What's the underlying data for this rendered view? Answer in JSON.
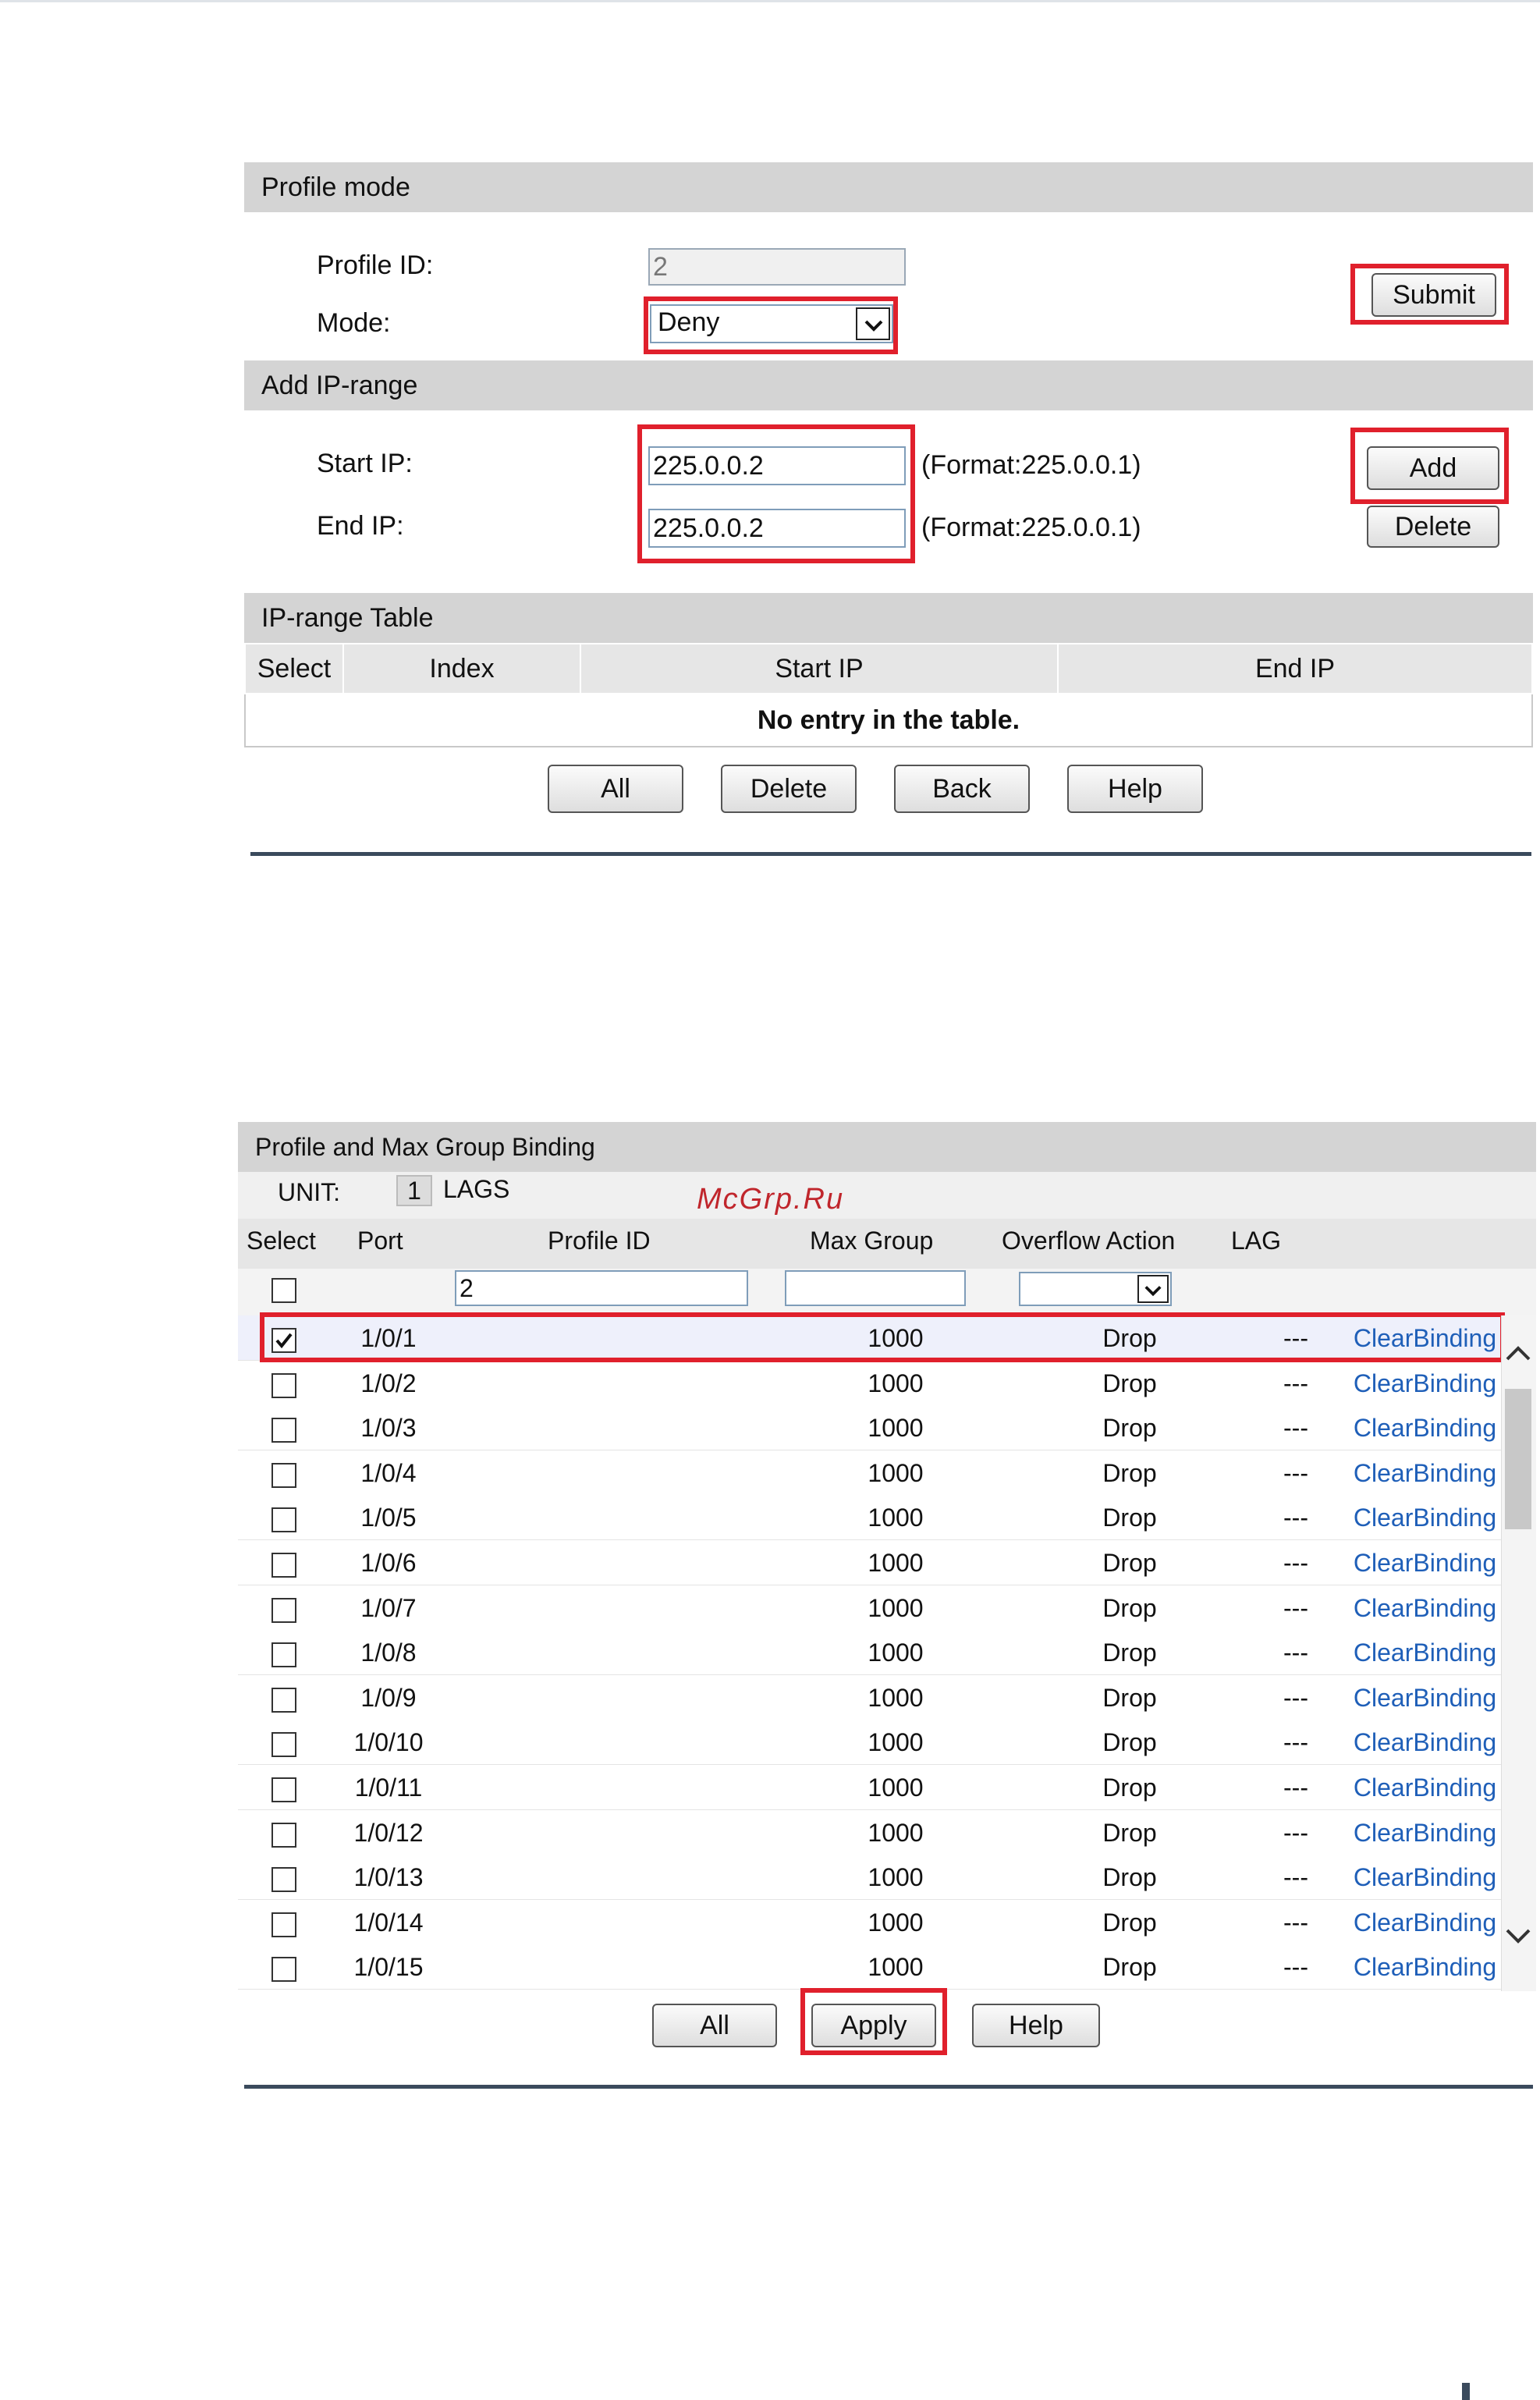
{
  "profile_form": {
    "section_profile_mode": "Profile mode",
    "profile_id_label": "Profile ID:",
    "profile_id_value": "2",
    "mode_label": "Mode:",
    "mode_value": "Deny",
    "submit_label": "Submit",
    "section_add_ip_range": "Add IP-range",
    "start_ip_label": "Start IP:",
    "start_ip_value": "225.0.0.2",
    "end_ip_label": "End IP:",
    "end_ip_value": "225.0.0.2",
    "format_hint": "(Format:225.0.0.1)",
    "add_label": "Add",
    "delete_label": "Delete",
    "section_ip_range_table": "IP-range Table",
    "table_headers": [
      "Select",
      "Index",
      "Start IP",
      "End IP"
    ],
    "empty_message": "No entry in the table.",
    "bottom_buttons": [
      "All",
      "Delete",
      "Back",
      "Help"
    ]
  },
  "binding_form": {
    "section_title": "Profile and Max Group Binding",
    "unit_label": "UNIT:",
    "unit_value": "1",
    "lags_label": "LAGS",
    "headers": [
      "Select",
      "Port",
      "Profile ID",
      "Max Group",
      "Overflow Action",
      "LAG"
    ],
    "filter_profile_id": "2",
    "rows": [
      {
        "port": "1/0/1",
        "max_group": "1000",
        "action": "Drop",
        "lag": "---",
        "link": "ClearBinding",
        "checked": true
      },
      {
        "port": "1/0/2",
        "max_group": "1000",
        "action": "Drop",
        "lag": "---",
        "link": "ClearBinding",
        "checked": false
      },
      {
        "port": "1/0/3",
        "max_group": "1000",
        "action": "Drop",
        "lag": "---",
        "link": "ClearBinding",
        "checked": false
      },
      {
        "port": "1/0/4",
        "max_group": "1000",
        "action": "Drop",
        "lag": "---",
        "link": "ClearBinding",
        "checked": false
      },
      {
        "port": "1/0/5",
        "max_group": "1000",
        "action": "Drop",
        "lag": "---",
        "link": "ClearBinding",
        "checked": false
      },
      {
        "port": "1/0/6",
        "max_group": "1000",
        "action": "Drop",
        "lag": "---",
        "link": "ClearBinding",
        "checked": false
      },
      {
        "port": "1/0/7",
        "max_group": "1000",
        "action": "Drop",
        "lag": "---",
        "link": "ClearBinding",
        "checked": false
      },
      {
        "port": "1/0/8",
        "max_group": "1000",
        "action": "Drop",
        "lag": "---",
        "link": "ClearBinding",
        "checked": false
      },
      {
        "port": "1/0/9",
        "max_group": "1000",
        "action": "Drop",
        "lag": "---",
        "link": "ClearBinding",
        "checked": false
      },
      {
        "port": "1/0/10",
        "max_group": "1000",
        "action": "Drop",
        "lag": "---",
        "link": "ClearBinding",
        "checked": false
      },
      {
        "port": "1/0/11",
        "max_group": "1000",
        "action": "Drop",
        "lag": "---",
        "link": "ClearBinding",
        "checked": false
      },
      {
        "port": "1/0/12",
        "max_group": "1000",
        "action": "Drop",
        "lag": "---",
        "link": "ClearBinding",
        "checked": false
      },
      {
        "port": "1/0/13",
        "max_group": "1000",
        "action": "Drop",
        "lag": "---",
        "link": "ClearBinding",
        "checked": false
      },
      {
        "port": "1/0/14",
        "max_group": "1000",
        "action": "Drop",
        "lag": "---",
        "link": "ClearBinding",
        "checked": false
      },
      {
        "port": "1/0/15",
        "max_group": "1000",
        "action": "Drop",
        "lag": "---",
        "link": "ClearBinding",
        "checked": false
      }
    ],
    "bottom_buttons": [
      "All",
      "Apply",
      "Help"
    ]
  },
  "watermark": "McGrp.Ru",
  "colors": {
    "highlight": "#e0202c",
    "link": "#1f5fb8",
    "section_bar": "#d4d4d4"
  }
}
